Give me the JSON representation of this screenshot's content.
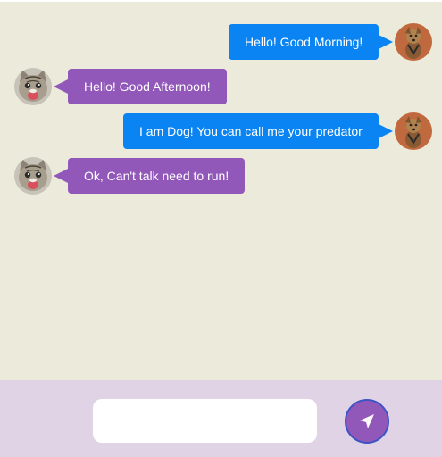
{
  "messages": [
    {
      "sender": "dog",
      "avatar_icon": "dog-avatar-icon",
      "text": "Hello! Good Morning!"
    },
    {
      "sender": "cat",
      "avatar_icon": "cat-avatar-icon",
      "text": "Hello! Good Afternoon!"
    },
    {
      "sender": "dog",
      "avatar_icon": "dog-avatar-icon",
      "text": "I am Dog! You can call me your predator"
    },
    {
      "sender": "cat",
      "avatar_icon": "cat-avatar-icon",
      "text": "Ok, Can't talk need to run!"
    }
  ],
  "composer": {
    "input_value": "",
    "input_placeholder": "",
    "send_icon": "send-icon"
  },
  "colors": {
    "chat_background": "#ecebdb",
    "composer_background": "#e0d3e6",
    "dog_bubble": "#0a84f2",
    "cat_bubble": "#9157b9",
    "send_button": "#9157b9"
  }
}
